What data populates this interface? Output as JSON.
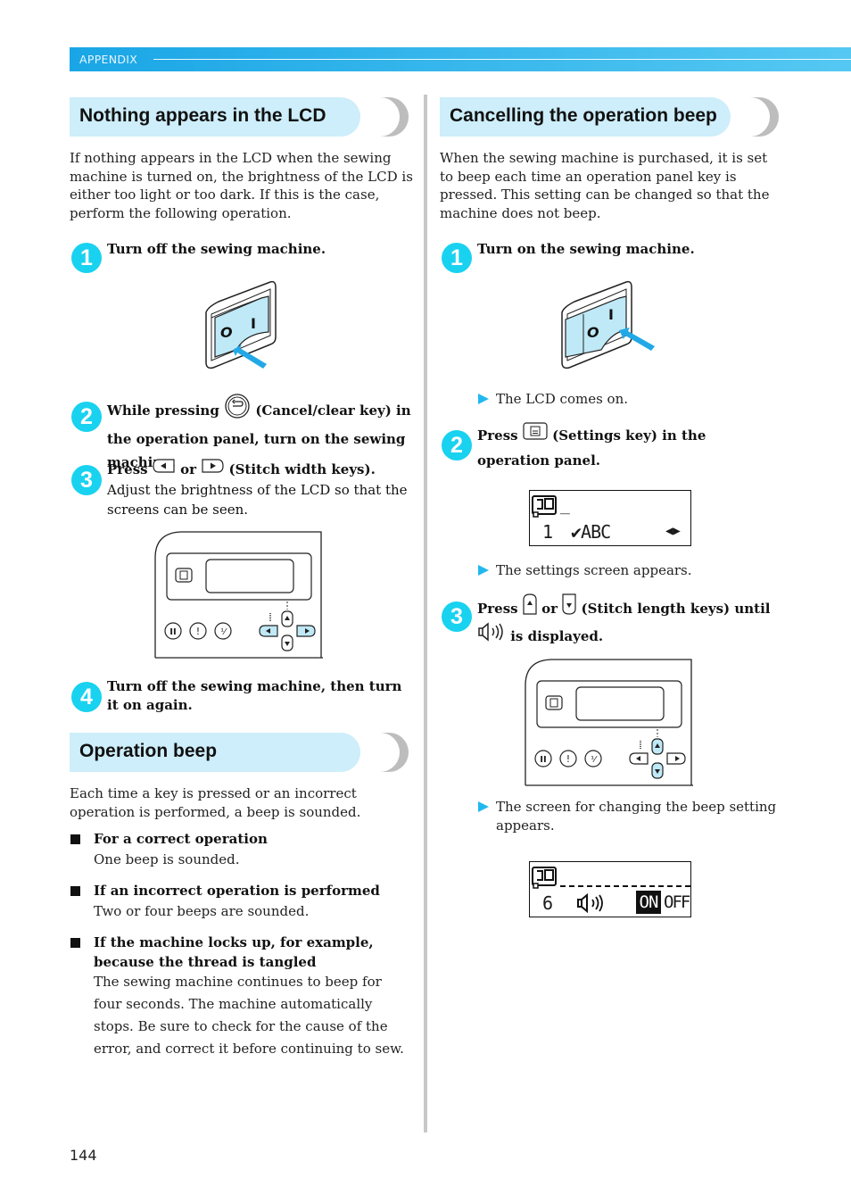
{
  "header": {
    "section_label": "APPENDIX",
    "accent_color": "#1aa6e6"
  },
  "left": {
    "section1": {
      "title": "Nothing appears in the LCD",
      "intro": "If nothing appears in the LCD when the sewing machine is turned on, the brightness of the LCD is either too light or too dark. If this is the case, perform the following operation.",
      "steps": [
        {
          "num": "1",
          "text": "Turn off the sewing machine."
        },
        {
          "num": "2",
          "text_before": "While pressing",
          "key_name": "cancel-clear-key",
          "text_after": "(Cancel/clear key) in the operation panel, turn on the sewing machine."
        },
        {
          "num": "3",
          "text_before": "Press",
          "or": "or",
          "text_after": "(Stitch width keys).",
          "sub": "Adjust the brightness of the LCD so that the screens can be seen."
        },
        {
          "num": "4",
          "text": "Turn off the sewing machine, then turn it on again."
        }
      ],
      "switch_labels": {
        "off": "O",
        "on": "I"
      }
    },
    "section2": {
      "title": "Operation beep",
      "intro": "Each time a key is pressed or an incorrect operation is performed, a beep is sounded.",
      "bullets": [
        {
          "head": "For a correct operation",
          "body": "One beep is sounded."
        },
        {
          "head": "If an incorrect operation is performed",
          "body": "Two or four beeps are sounded."
        },
        {
          "head": "If the machine locks up, for example, because the thread is tangled",
          "body": "The sewing machine continues to beep for four seconds. The machine automatically stops. Be sure to check for the cause of the error, and correct it before continuing to sew."
        }
      ]
    }
  },
  "right": {
    "section": {
      "title": "Cancelling the operation beep",
      "intro": "When the sewing machine is purchased, it is set to beep each time an operation panel key is pressed. This setting can be changed so that the machine does not beep.",
      "steps": [
        {
          "num": "1",
          "text": "Turn on the sewing machine.",
          "result": "The LCD comes on."
        },
        {
          "num": "2",
          "text_before": "Press",
          "text_after": "(Settings key) in the operation panel.",
          "result": "The settings screen appears."
        },
        {
          "num": "3",
          "text_before": "Press",
          "or": "or",
          "text_mid": "(Stitch length keys) until",
          "text_after": "is displayed.",
          "result": "The screen for changing the beep setting appears."
        }
      ],
      "lcd_settings": {
        "row2_num": "1",
        "row2_text": "✔ABC"
      },
      "lcd_beep": {
        "row2_num": "6",
        "on_label": "ON",
        "off_label": "OFF",
        "selected": "ON"
      }
    }
  },
  "footer": {
    "page_number": "144"
  }
}
